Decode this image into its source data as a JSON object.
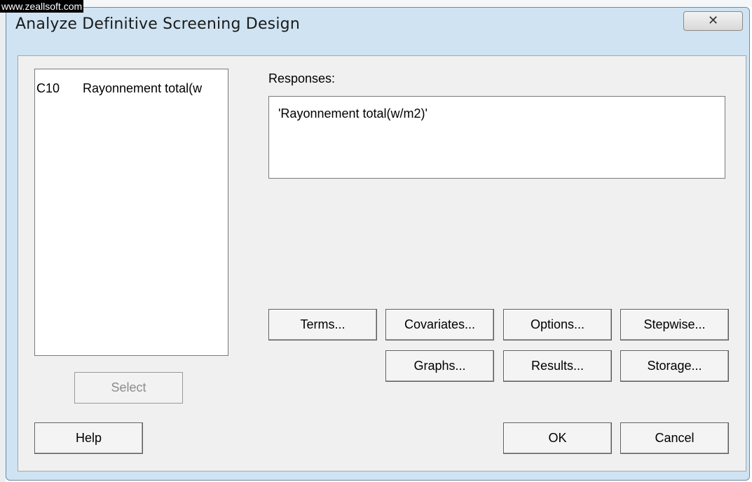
{
  "watermark": "www.zeallsoft.com",
  "window": {
    "title": "Analyze Definitive Screening Design",
    "close_icon": "close-x-icon",
    "close_glyph": "✕"
  },
  "variables": {
    "items": [
      {
        "column": "C10",
        "name": "Rayonnement total(w"
      }
    ]
  },
  "responses": {
    "label": "Responses:",
    "value": "'Rayonnement total(w/m2)'"
  },
  "buttons": {
    "select": "Select",
    "help": "Help",
    "terms": "Terms...",
    "covariates": "Covariates...",
    "options": "Options...",
    "stepwise": "Stepwise...",
    "graphs": "Graphs...",
    "results": "Results...",
    "storage": "Storage...",
    "ok": "OK",
    "cancel": "Cancel"
  }
}
